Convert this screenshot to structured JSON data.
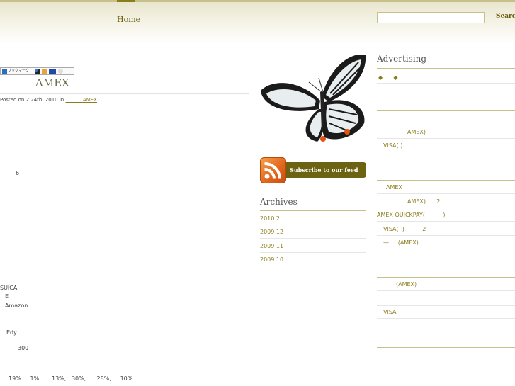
{
  "nav": {
    "home": "Home"
  },
  "search": {
    "button": "Search",
    "value": ""
  },
  "bookmark": {
    "label": "ブックマーク"
  },
  "post": {
    "title": "AMEX",
    "meta_prefix": "Posted on 2  24th, 2010 in ",
    "meta_category": "AMEX",
    "meta_category_underline": "           ",
    "body": {
      "l1": "6",
      "l2": "SUICA",
      "l3": "E",
      "l4": "Amazon",
      "l5": "Edy",
      "l6": "300",
      "l7": "19%     1%       13%,   30%,      28%,     10%"
    }
  },
  "rss": {
    "label": "Subscribe to our feed"
  },
  "archives": {
    "title": "Archives",
    "items": [
      "2010 2",
      "2009 12",
      "2009 11",
      "2009 10"
    ]
  },
  "advertising": {
    "title": "Advertising",
    "diamonds": "◆      ◆",
    "links": [
      "AMEX)",
      "VISA(  )",
      "AMEX",
      "AMEX)      2",
      "AMEX QUICKPAY(          )",
      "VISA(  )          2",
      "—     (AMEX)",
      "(AMEX)",
      "VISA"
    ]
  }
}
